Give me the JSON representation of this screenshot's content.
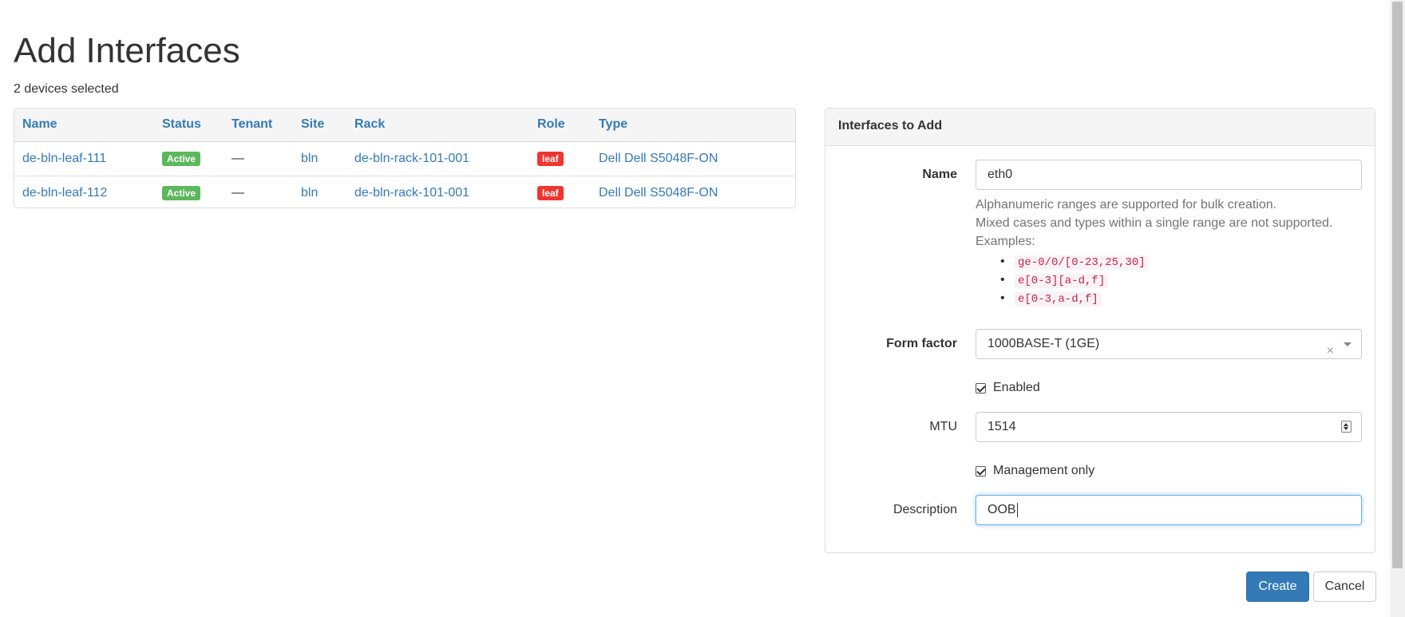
{
  "page": {
    "title": "Add Interfaces",
    "subtitle": "2 devices selected"
  },
  "devices_table": {
    "columns": [
      "Name",
      "Status",
      "Tenant",
      "Site",
      "Rack",
      "Role",
      "Type"
    ],
    "rows": [
      {
        "name": "de-bln-leaf-111",
        "status": "Active",
        "tenant": "—",
        "site": "bln",
        "rack": "de-bln-rack-101-001",
        "role": "leaf",
        "type": "Dell Dell S5048F-ON"
      },
      {
        "name": "de-bln-leaf-112",
        "status": "Active",
        "tenant": "—",
        "site": "bln",
        "rack": "de-bln-rack-101-001",
        "role": "leaf",
        "type": "Dell Dell S5048F-ON"
      }
    ]
  },
  "form": {
    "heading": "Interfaces to Add",
    "name": {
      "label": "Name",
      "value": "eth0",
      "help_lines": [
        "Alphanumeric ranges are supported for bulk creation.",
        "Mixed cases and types within a single range are not supported.",
        "Examples:"
      ],
      "examples": [
        "ge-0/0/[0-23,25,30]",
        "e[0-3][a-d,f]",
        "e[0-3,a-d,f]"
      ]
    },
    "form_factor": {
      "label": "Form factor",
      "value": "1000BASE-T (1GE)",
      "clear_glyph": "×"
    },
    "enabled": {
      "label": "Enabled",
      "checked": true
    },
    "mtu": {
      "label": "MTU",
      "value": "1514"
    },
    "mgmt_only": {
      "label": "Management only",
      "checked": true
    },
    "description": {
      "label": "Description",
      "value": "OOB"
    }
  },
  "buttons": {
    "create": "Create",
    "cancel": "Cancel"
  },
  "colors": {
    "link": "#337ab7",
    "active_badge": "#5cb85c",
    "role_badge": "#f0352f",
    "primary_button": "#337ab7"
  }
}
